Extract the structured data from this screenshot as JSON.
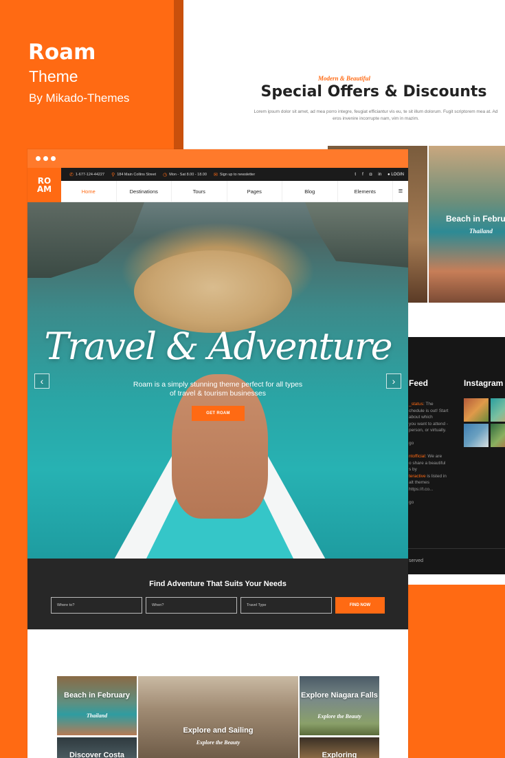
{
  "brand": {
    "title": "Roam",
    "subtitle": "Theme",
    "author": "By Mikado-Themes"
  },
  "offers": {
    "tagline": "Modern & Beautiful",
    "title": "Special Offers & Discounts",
    "text": "Lorem ipsum dolor sit amet, ad mea porro integre, feugiat efficiantur vis eu, te sit illum dolorum. Fugit scriptorem mea at. Ad eros invenire incorrupte nam, vim in mazim.",
    "card_title": "Beach in Febru",
    "card_sub": "Thailand"
  },
  "footer": {
    "feed_title": "Feed",
    "instagram_title": "Instagram",
    "feed_lines": [
      {
        "hl": "_status",
        "text": ": The"
      },
      {
        "hl": "",
        "text": "chedule is out! Start"
      },
      {
        "hl": "",
        "text": "about which"
      },
      {
        "hl": "",
        "text": "you want to attend -"
      },
      {
        "hl": "",
        "text": "person, or virtually."
      },
      {
        "hl": "",
        "text": ""
      },
      {
        "hl": "",
        "text": "go"
      },
      {
        "hl": "",
        "text": ""
      },
      {
        "hl": "ntofficial",
        "text": ": We are"
      },
      {
        "hl": "",
        "text": "o share a beautiful"
      },
      {
        "hl": "",
        "text": "s by"
      },
      {
        "hl": "teractive",
        "text": " is listed in"
      },
      {
        "hl": "",
        "text": "alt themes"
      },
      {
        "hl": "",
        "text": "https://t.co..."
      },
      {
        "hl": "",
        "text": ""
      },
      {
        "hl": "",
        "text": "go"
      }
    ],
    "reserved": "served"
  },
  "site": {
    "logo_top": "RO",
    "logo_bottom": "AM",
    "topbar": {
      "phone": "1-677-124-44227",
      "address": "184 Main Collins Street",
      "hours": "Mon - Sat 8.00 - 18.00",
      "newsletter": "Sign up to newsletter",
      "login": "LOGIN",
      "social": [
        "t",
        "f",
        "◘",
        "in"
      ]
    },
    "nav": [
      "Home",
      "Destinations",
      "Tours",
      "Pages",
      "Blog",
      "Elements"
    ],
    "nav_menu_icon": "≡",
    "hero": {
      "script_title": "Travel & Adventure",
      "text": "Roam is a simply stunning theme perfect for all types of travel & tourism businesses",
      "button": "GET ROAM",
      "prev": "‹",
      "next": "›"
    },
    "search": {
      "title": "Find Adventure That Suits Your Needs",
      "where": "Where to?",
      "when": "When?",
      "type": "Travel Type",
      "button": "FIND NOW"
    },
    "tiles": [
      {
        "title": "Beach in February",
        "sub": "Thailand"
      },
      {
        "title": "Explore and Sailing",
        "sub": "Explore the Beauty"
      },
      {
        "title": "Explore Niagara Falls",
        "sub": "Explore the Beauty"
      },
      {
        "title": "Discover Costa",
        "sub": ""
      },
      {
        "title": "Exploring",
        "sub": ""
      }
    ]
  },
  "colors": {
    "accent": "#ff6a13",
    "dark": "#272727"
  }
}
